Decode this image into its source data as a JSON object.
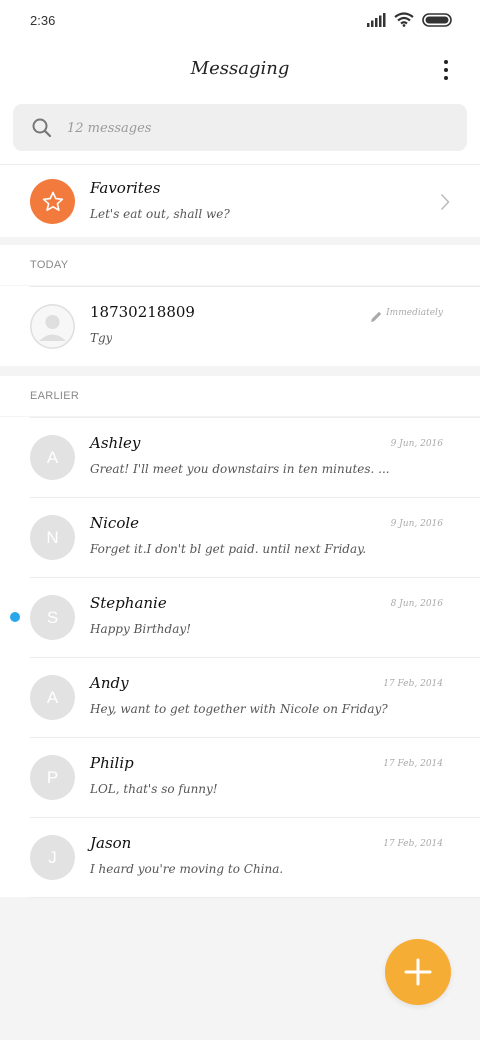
{
  "status_bar": {
    "time": "2:36",
    "icons": [
      "signal-icon",
      "wifi-icon",
      "battery-icon"
    ]
  },
  "header": {
    "title": "Messaging",
    "more_icon": "more-vertical-icon"
  },
  "search": {
    "placeholder": "12 messages",
    "icon": "search-icon"
  },
  "favorites": {
    "title": "Favorites",
    "preview": "Let's eat out, shall we?",
    "icon": "star-icon",
    "color": "#f27a3c"
  },
  "sections": {
    "today": "TODAY",
    "earlier": "EARLIER"
  },
  "today_threads": [
    {
      "name": "18730218809",
      "preview": "Tgy",
      "time": "Immediately",
      "avatar": "person-icon"
    }
  ],
  "earlier_threads": [
    {
      "initial": "A",
      "name": "Ashley",
      "preview": "Great! I'll meet you downstairs in ten minutes. ...",
      "time": "9 Jun, 2016",
      "unread": false
    },
    {
      "initial": "N",
      "name": "Nicole",
      "preview": "Forget it.I don't bl get paid. until next Friday.",
      "time": "9 Jun, 2016",
      "unread": false
    },
    {
      "initial": "S",
      "name": "Stephanie",
      "preview": "Happy Birthday!",
      "time": "8 Jun, 2016",
      "unread": true
    },
    {
      "initial": "A",
      "name": "Andy",
      "preview": "Hey, want to get together with Nicole on Friday?",
      "time": "17 Feb, 2014",
      "unread": false
    },
    {
      "initial": "P",
      "name": "Philip",
      "preview": "LOL, that's so funny!",
      "time": "17 Feb, 2014",
      "unread": false
    },
    {
      "initial": "J",
      "name": "Jason",
      "preview": "I heard you're moving to China.",
      "time": "17 Feb, 2014",
      "unread": false
    }
  ],
  "fab": {
    "icon": "plus-icon",
    "color": "#f6ad35"
  },
  "colors": {
    "unread": "#2aa7ea",
    "avatar_bg": "#e2e2e2"
  }
}
